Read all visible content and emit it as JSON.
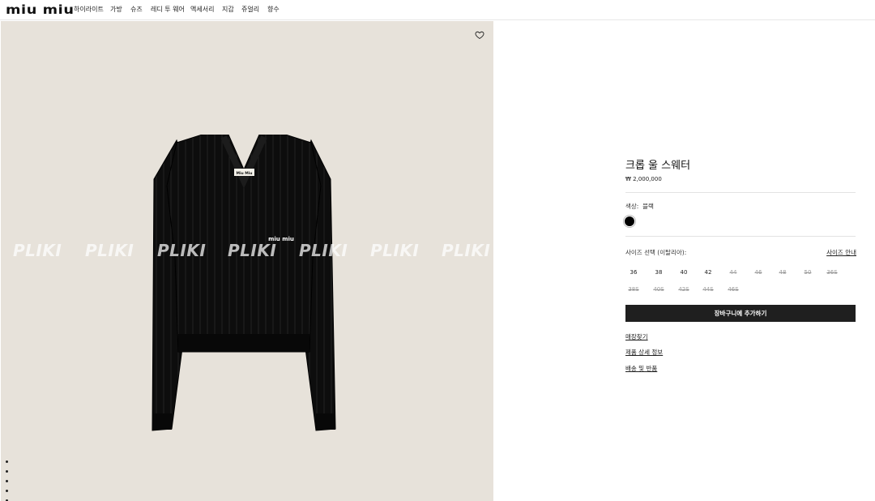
{
  "header": {
    "logo": "miu miu",
    "nav": [
      "하이라이트",
      "가방",
      "슈즈",
      "레디 투 웨어",
      "액세서리",
      "지갑",
      "쥬얼리",
      "향수"
    ]
  },
  "image": {
    "watermark": "PLIKI",
    "sweater_label": "Miu Miu",
    "chest_logo": "miu miu",
    "gallery_count": 5,
    "colors": {
      "background": "#e7e2da",
      "garment": "#0d0d0d"
    }
  },
  "product": {
    "title": "크롭 울 스웨터",
    "price": "₩ 2,000,000",
    "color_label": "색상:",
    "color_value": "블랙",
    "size_label": "사이즈 선택 (이탈리아):",
    "size_guide": "사이즈 안내",
    "sizes": [
      {
        "label": "36",
        "available": true
      },
      {
        "label": "38",
        "available": true
      },
      {
        "label": "40",
        "available": true
      },
      {
        "label": "42",
        "available": true
      },
      {
        "label": "44",
        "available": false
      },
      {
        "label": "46",
        "available": false
      },
      {
        "label": "48",
        "available": false
      },
      {
        "label": "50",
        "available": false
      },
      {
        "label": "36S",
        "available": false
      },
      {
        "label": "38S",
        "available": false
      },
      {
        "label": "40S",
        "available": false
      },
      {
        "label": "42S",
        "available": false
      },
      {
        "label": "44S",
        "available": false
      },
      {
        "label": "46S",
        "available": false
      }
    ],
    "add_to_cart": "장바구니에 추가하기",
    "links": [
      "매장찾기",
      "제품 상세 정보",
      "배송 및 반품"
    ]
  }
}
